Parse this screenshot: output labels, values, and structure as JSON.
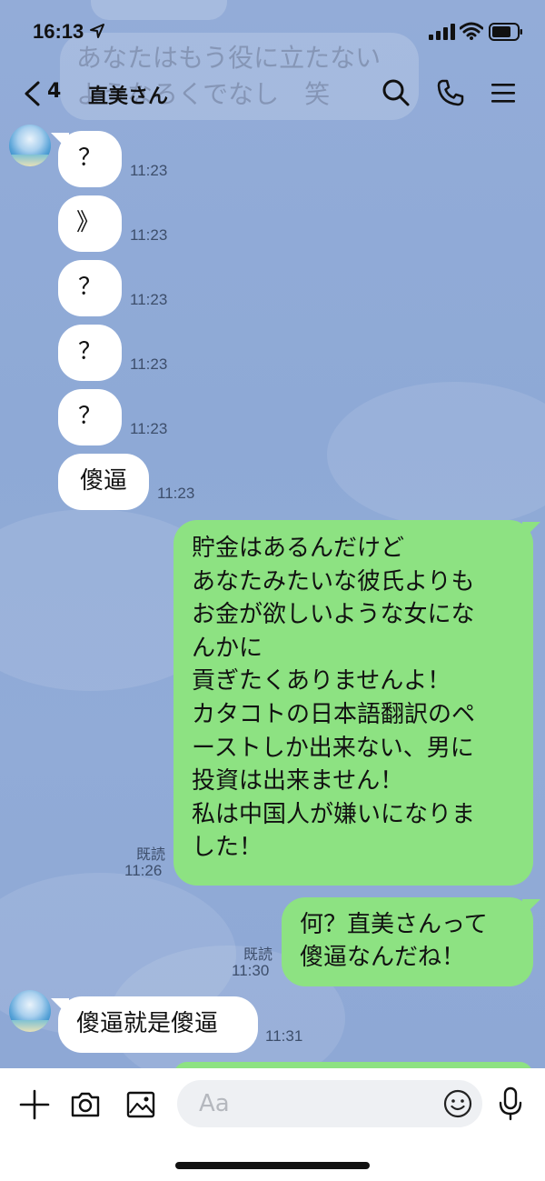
{
  "status_bar": {
    "time": "16:13"
  },
  "ghost": {
    "line1": "あなたはもう役に立たない",
    "line2": "ようなろくでなし　笑"
  },
  "header": {
    "unread_count": "4",
    "title": "直美さん"
  },
  "messages": [
    {
      "side": "in",
      "text": "？",
      "time": "11:23"
    },
    {
      "side": "in",
      "text": "》",
      "time": "11:23"
    },
    {
      "side": "in",
      "text": "？",
      "time": "11:23"
    },
    {
      "side": "in",
      "text": "？",
      "time": "11:23"
    },
    {
      "side": "in",
      "text": "？",
      "time": "11:23"
    },
    {
      "side": "in",
      "text": "傻逼",
      "time": "11:23"
    },
    {
      "side": "out",
      "text": "貯金はあるんだけど\nあなたみたいな彼氏よりも\nお金が欲しいような女にな\nんかに\n貢ぎたくありませんよ！\nカタコトの日本語翻訳のペ\nーストしか出来ない、男に\n投資は出来ません！\n私は中国人が嫌いになりま\nした！",
      "read": "既読",
      "time": "11:26"
    },
    {
      "side": "out",
      "text": "何？直美さんって\n傻逼なんだね！",
      "read": "既読",
      "time": "11:30"
    },
    {
      "side": "in",
      "text": "傻逼就是傻逼",
      "time": "11:31"
    }
  ],
  "input": {
    "placeholder": "Aa"
  },
  "colors": {
    "chat_bg": "#8faad6",
    "out_bubble": "#8de282",
    "in_bubble": "#ffffff"
  }
}
